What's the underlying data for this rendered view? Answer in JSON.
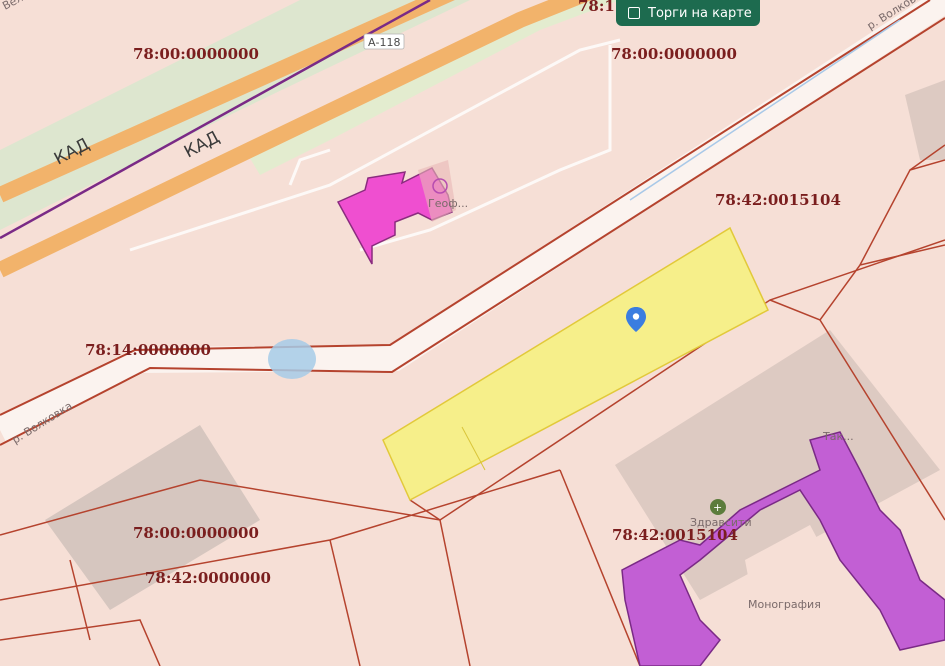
{
  "map": {
    "road_labels": [
      "КАД",
      "КАД",
      "А-118",
      "Вел...",
      "р. Волковка",
      "р. Волковка"
    ],
    "cadastral_labels": [
      "78:1...",
      "78:00:0000000",
      "78:00:0000000",
      "78:42:0015104",
      "78:14:0000000",
      "78:00:0000000",
      "78:42:0000000",
      "78:42:0015104"
    ],
    "poi_labels": [
      "Геоф...",
      "Здравсити",
      "Монография",
      "Так..."
    ]
  },
  "toggle": {
    "label": "Торги на карте",
    "checked": false
  },
  "colors": {
    "background": "#f6dfd6",
    "highway": "#f2b36b",
    "boundary": "#b5432e",
    "selected_parcel": "#f6ef8a",
    "building_magenta": "#ef4fd0",
    "building_purple": "#c25fd4",
    "marker": "#3b7de0",
    "toggle_bg": "#1d6b4f"
  }
}
